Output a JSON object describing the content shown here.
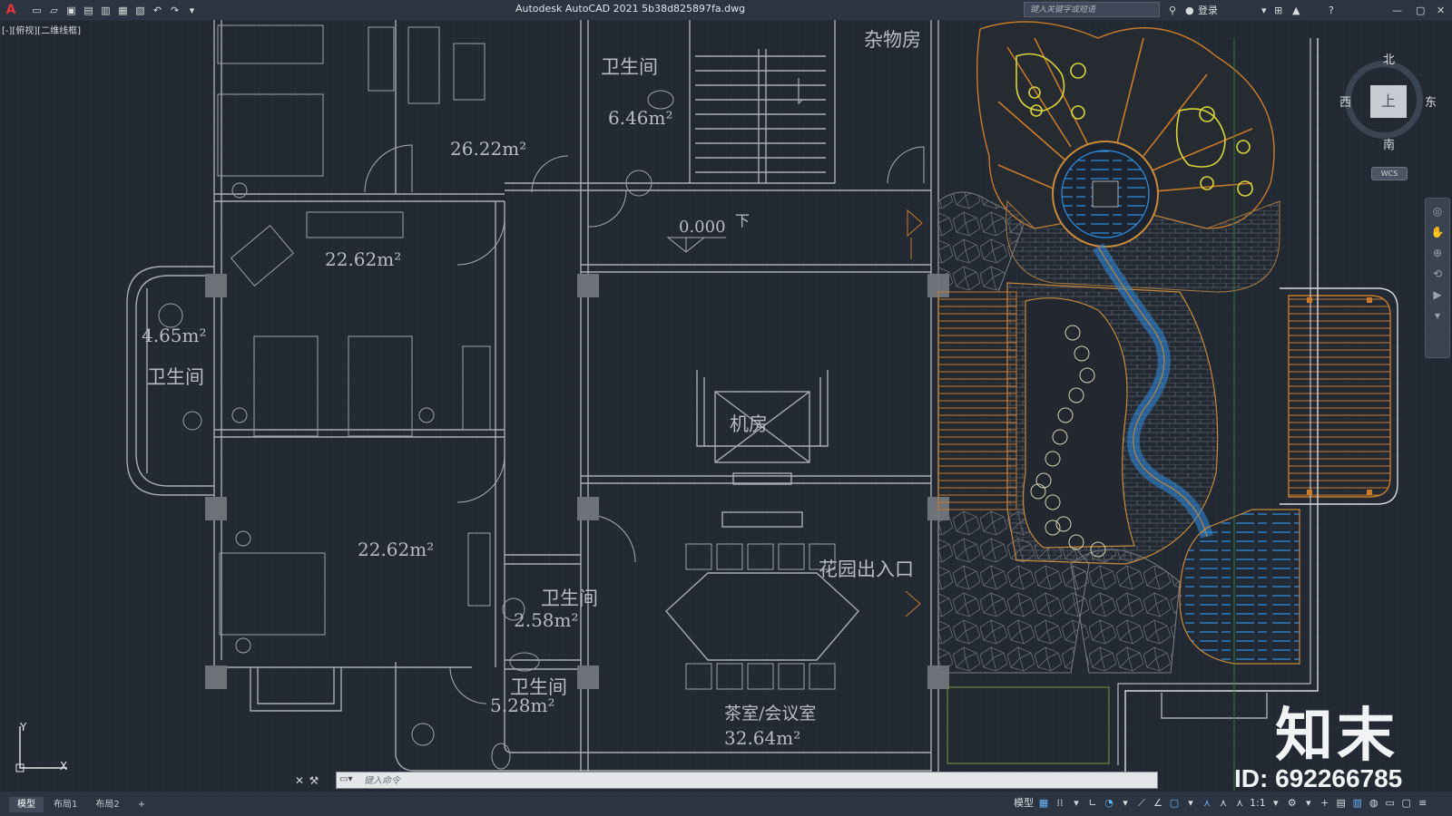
{
  "app": {
    "title": "Autodesk AutoCAD 2021    5b38d825897fa.dwg",
    "search_placeholder": "键入关键字或短语",
    "login": "登录",
    "view_label": "[-][俯视][二维线框]"
  },
  "compass": {
    "north": "北",
    "south": "南",
    "west": "西",
    "east": "东",
    "top": "上",
    "wcs": "WCS"
  },
  "drawing": {
    "rooms": [
      {
        "name": "杂物房"
      },
      {
        "name": "卫生间",
        "area": "6.46m²"
      },
      {
        "name": "",
        "area": "26.22m²"
      },
      {
        "name": "",
        "area": "22.62m²"
      },
      {
        "name": "卫生间",
        "area": "4.65m²"
      },
      {
        "name": "",
        "area": "22.62m²"
      },
      {
        "name": "卫生间",
        "area": "2.58m²"
      },
      {
        "name": "卫生间",
        "area": "5.28m²"
      },
      {
        "name": "机房"
      },
      {
        "name": "花园出入口"
      },
      {
        "name": "茶室/会议室",
        "area": "32.64m²"
      }
    ],
    "level": "0.000",
    "down": "下",
    "ucs_x": "X",
    "ucs_y": "Y"
  },
  "command": {
    "placeholder": "键入命令"
  },
  "status": {
    "tabs": [
      "模型",
      "布局1",
      "布局2"
    ],
    "add_tab": "+",
    "model": "模型",
    "scale": "1:1"
  },
  "watermark": {
    "logo": "知末",
    "id": "ID: 692266785"
  },
  "colors": {
    "background": "#222933",
    "walls": "#a9adb3",
    "garden_orange": "#c97b2a",
    "garden_yellow": "#d8d53a",
    "water_blue": "#2f8de0"
  }
}
